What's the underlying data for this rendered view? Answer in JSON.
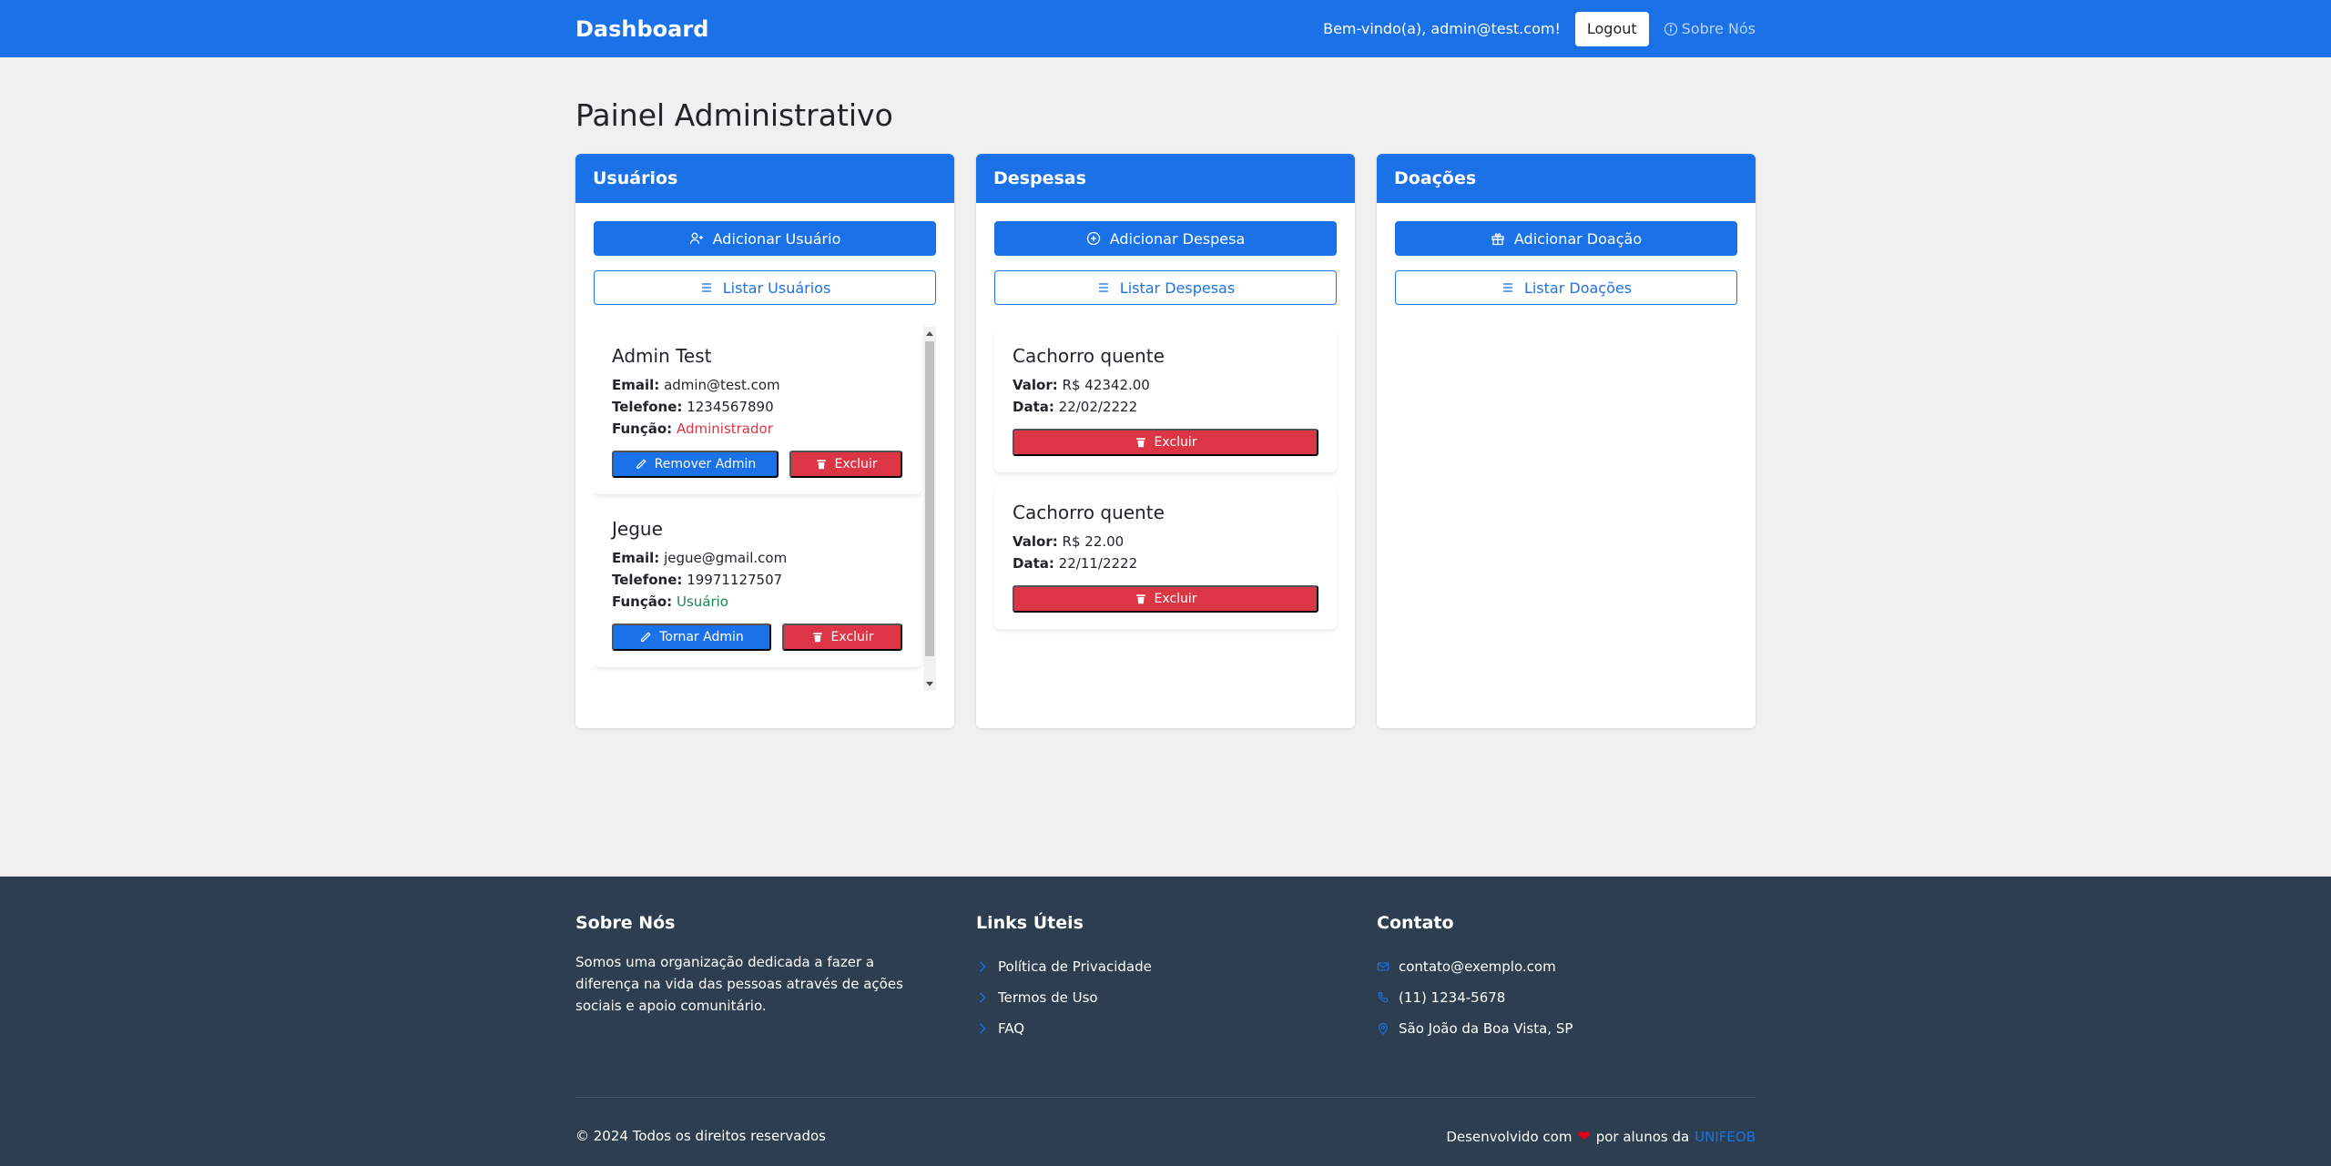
{
  "navbar": {
    "brand": "Dashboard",
    "welcome": "Bem-vindo(a), admin@test.com!",
    "logout_label": "Logout",
    "about_label": "Sobre Nós"
  },
  "page": {
    "title": "Painel Administrativo"
  },
  "users": {
    "header": "Usuários",
    "add_label": "Adicionar Usuário",
    "list_label": "Listar Usuários",
    "items": [
      {
        "name": "Admin Test",
        "email_label": "Email:",
        "email": "admin@test.com",
        "phone_label": "Telefone:",
        "phone": "1234567890",
        "role_label": "Função:",
        "role": "Administrador",
        "toggle_label": "Remover Admin",
        "delete_label": "Excluir"
      },
      {
        "name": "Jegue",
        "email_label": "Email:",
        "email": "jegue@gmail.com",
        "phone_label": "Telefone:",
        "phone": "19971127507",
        "role_label": "Função:",
        "role": "Usuário",
        "toggle_label": "Tornar Admin",
        "delete_label": "Excluir"
      }
    ]
  },
  "expenses": {
    "header": "Despesas",
    "add_label": "Adicionar Despesa",
    "list_label": "Listar Despesas",
    "items": [
      {
        "name": "Cachorro quente",
        "value_label": "Valor:",
        "value": "R$ 42342.00",
        "date_label": "Data:",
        "date": "22/02/2222",
        "delete_label": "Excluir"
      },
      {
        "name": "Cachorro quente",
        "value_label": "Valor:",
        "value": "R$ 22.00",
        "date_label": "Data:",
        "date": "22/11/2222",
        "delete_label": "Excluir"
      }
    ]
  },
  "donations": {
    "header": "Doações",
    "add_label": "Adicionar Doação",
    "list_label": "Listar Doações"
  },
  "footer": {
    "about_title": "Sobre Nós",
    "about_text": "Somos uma organização dedicada a fazer a diferença na vida das pessoas através de ações sociais e apoio comunitário.",
    "links_title": "Links Úteis",
    "links": [
      "Política de Privacidade",
      "Termos de Uso",
      "FAQ"
    ],
    "contact_title": "Contato",
    "email": "contato@exemplo.com",
    "phone": "(11) 1234-5678",
    "location": "São João da Boa Vista, SP",
    "copyright": "© 2024 Todos os direitos reservados",
    "credit_prefix": "Desenvolvido com",
    "credit_middle": "por alunos da",
    "credit_brand": "UNIFEOB"
  },
  "colors": {
    "primary": "#1b72e8",
    "danger": "#dc3545",
    "success": "#198754",
    "footer_bg": "#2c3e50"
  }
}
